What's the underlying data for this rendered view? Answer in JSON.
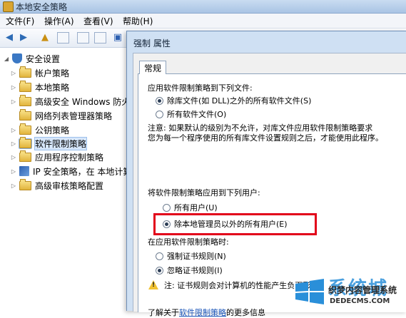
{
  "window": {
    "title": "本地安全策略"
  },
  "menu": {
    "items": [
      "文件(F)",
      "操作(A)",
      "查看(V)",
      "帮助(H)"
    ]
  },
  "tree": {
    "root": "安全设置",
    "items": [
      {
        "label": "帐户策略",
        "expandable": true
      },
      {
        "label": "本地策略",
        "expandable": true
      },
      {
        "label": "高级安全 Windows 防火墙",
        "expandable": true
      },
      {
        "label": "网络列表管理器策略",
        "expandable": false
      },
      {
        "label": "公钥策略",
        "expandable": true
      },
      {
        "label": "软件限制策略",
        "expandable": true,
        "selected": true
      },
      {
        "label": "应用程序控制策略",
        "expandable": true
      },
      {
        "label": "IP 安全策略，在 本地计算",
        "expandable": true
      },
      {
        "label": "高级审核策略配置",
        "expandable": true
      }
    ]
  },
  "dialog": {
    "title": "强制 属性",
    "tab": "常规",
    "apply_files_label": "应用软件限制策略到下列文件:",
    "opt_files_except_dll": "除库文件(如 DLL)之外的所有软件文件(S)",
    "opt_files_all": "所有软件文件(O)",
    "note_line1": "注意: 如果默认的级别为不允许，对库文件应用软件限制策略要求",
    "note_line2": "您为每一个程序使用的所有库文件设置规则之后，才能使用此程序。",
    "apply_users_label": "将软件限制策略应用到下列用户:",
    "opt_users_all": "所有用户(U)",
    "opt_users_except_admins": "除本地管理员以外的所有用户(E)",
    "enforce_label": "在应用软件限制策略时:",
    "opt_enforce_cert": "强制证书规则(N)",
    "opt_ignore_cert": "忽略证书规则(I)",
    "cert_note": "注: 证书规则会对计算机的性能产生负面影响。",
    "learn_prefix": "了解关于",
    "learn_link": "软件限制策略",
    "learn_suffix": "的更多信息"
  },
  "watermark": {
    "big_text": "系统城",
    "sub_text": "织梦内容管理系统",
    "domain_text": "DEDECMS.COM"
  },
  "colors": {
    "highlight_box": "#e2001a",
    "link": "#1a55b8",
    "accent": "#2a8fd9"
  }
}
